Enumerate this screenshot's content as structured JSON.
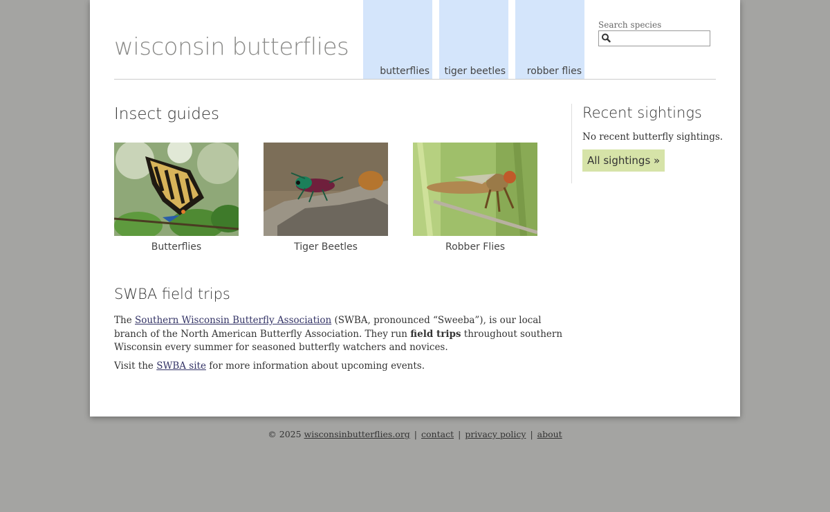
{
  "site": {
    "title": "wisconsin butterflies"
  },
  "nav": {
    "items": [
      {
        "label": "butterflies"
      },
      {
        "label": "tiger beetles"
      },
      {
        "label": "robber flies"
      }
    ]
  },
  "search": {
    "label": "Search species",
    "placeholder": "",
    "value": ""
  },
  "guides": {
    "heading": "Insect guides",
    "items": [
      {
        "caption": "Butterflies"
      },
      {
        "caption": "Tiger Beetles"
      },
      {
        "caption": "Robber Flies"
      }
    ]
  },
  "trips": {
    "heading": "SWBA field trips",
    "p1_before": "The ",
    "p1_link": "Southern Wisconsin Butterfly Association",
    "p1_middle": " (SWBA, pronounced “Sweeba”), is our local branch of the North American Butterfly Association. They run ",
    "p1_bold": "field trips",
    "p1_after": " throughout southern Wisconsin every summer for seasoned butterfly watchers and novices.",
    "p2_before": "Visit the ",
    "p2_link": "SWBA site",
    "p2_after": " for more information about upcoming events."
  },
  "sightings": {
    "heading": "Recent sightings",
    "empty_text": "No recent butterfly sightings.",
    "all_label": "All sightings »"
  },
  "footer": {
    "copyright": "© 2025 ",
    "site_link": "wisconsinbutterflies.org",
    "separator": "|",
    "contact": "contact",
    "privacy": "privacy policy",
    "about": "about"
  },
  "colors": {
    "background": "#a4a4a2",
    "nav_tab": "#d4e5fb",
    "sightings_button": "#d6e3a8",
    "link": "#333366"
  },
  "icons": {
    "search": "magnifier-icon"
  }
}
